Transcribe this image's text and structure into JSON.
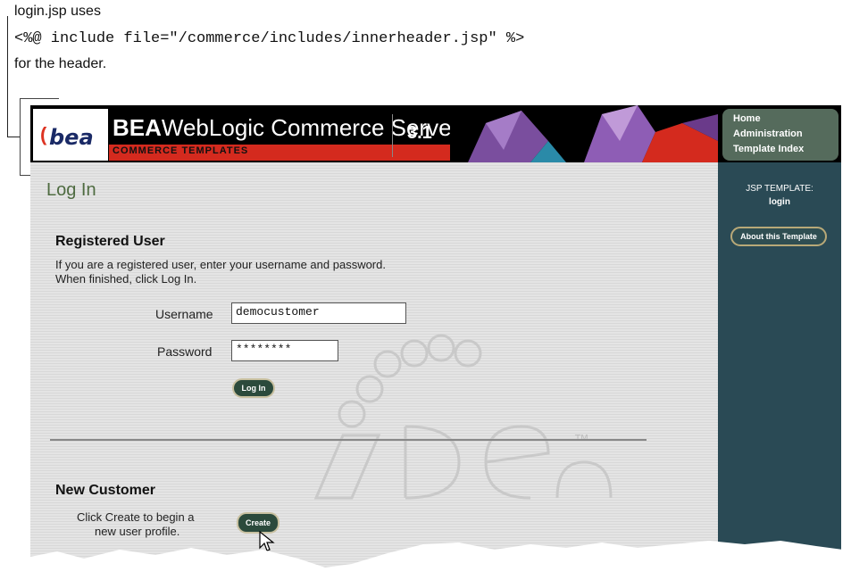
{
  "annotation": {
    "line1": "login.jsp uses",
    "code": "<%@ include file=\"/commerce/includes/innerheader.jsp\" %>",
    "line3": "for the header."
  },
  "header": {
    "logo": "bea",
    "brand_bold": "BEA",
    "brand_rest": "WebLogic Commerce Server",
    "subbrand": "COMMERCE TEMPLATES",
    "version": "3.1",
    "nav": [
      "Home",
      "Administration",
      "Template Index"
    ]
  },
  "main": {
    "title": "Log In",
    "registered": {
      "heading": "Registered User",
      "instructions_1": "If you are a registered user, enter your username and password.",
      "instructions_2": "When finished, click Log In.",
      "username_label": "Username",
      "username_value": "democustomer",
      "password_label": "Password",
      "password_value": "********",
      "login_button": "Log In"
    },
    "new_customer": {
      "heading": "New Customer",
      "text_1": "Click Create to begin a",
      "text_2": "new user profile.",
      "create_button": "Create"
    }
  },
  "sidebar": {
    "label": "JSP TEMPLATE:",
    "template_name": "login",
    "about_button": "About this Template"
  },
  "colors": {
    "header_bg": "#000000",
    "header_red": "#d42a1e",
    "title_green": "#4e6b40",
    "sidebar_bg": "#2a4a55",
    "button_bg": "#2b4a3c"
  }
}
